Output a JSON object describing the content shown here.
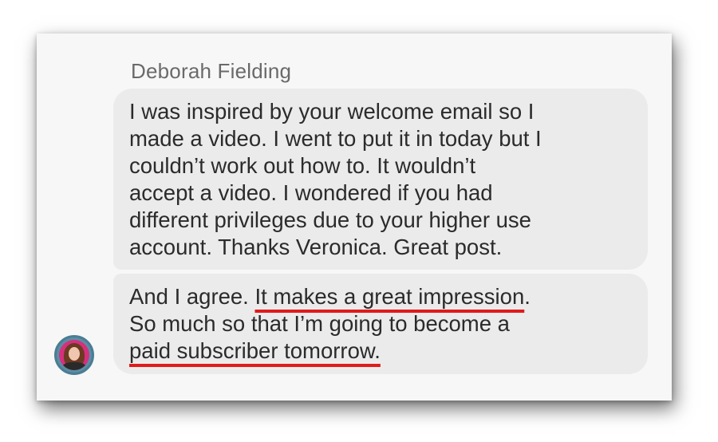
{
  "message": {
    "sender_name": "Deborah Fielding",
    "bubble_1_lines": [
      "I was inspired by your welcome email so I",
      "made a video. I went to put it in today but I",
      "couldn’t work out how to. It wouldn’t",
      "accept a video. I wondered if you had",
      "different privileges due to your higher use",
      "account. Thanks Veronica. Great post."
    ],
    "bubble_2": {
      "line1_pre": "And I agree. ",
      "line1_hl": "It makes a great impression",
      "line1_post": ".",
      "line2": "So much so that I’m going to become a",
      "line3_hl": "paid subscriber tomorrow."
    },
    "avatar_icon": "user-avatar-photo"
  },
  "colors": {
    "card_background": "#f7f7f7",
    "bubble_background": "#ebebeb",
    "text": "#2b2b2b",
    "sender_text": "#6a6a6a",
    "highlight_underline": "#e01b1b"
  }
}
